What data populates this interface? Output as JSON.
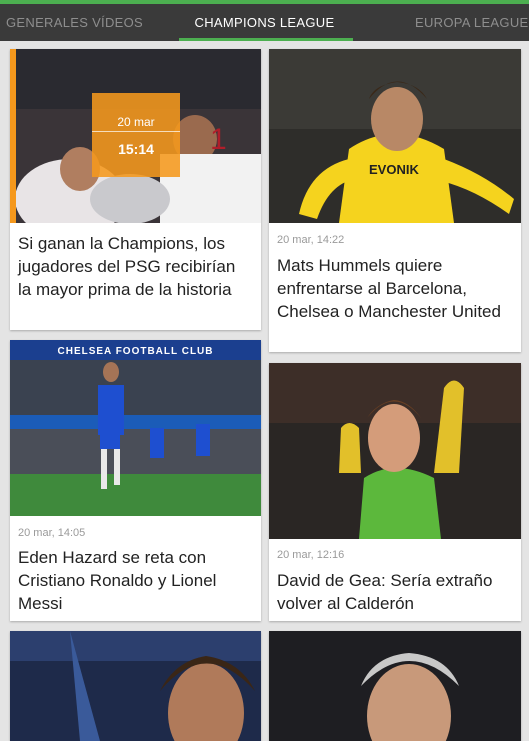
{
  "tabs": [
    {
      "label": "GENERALES VÍDEOS"
    },
    {
      "label": "CHAMPIONS LEAGUE"
    },
    {
      "label": "EUROPA LEAGUE"
    }
  ],
  "colors": {
    "accent": "#4caf50",
    "highlight": "#f5981c",
    "tabbar": "#3a3a3a"
  },
  "cards": [
    {
      "date": "20 mar",
      "time": "15:14",
      "title": "Si ganan la Champions, los jugadores del PSG recibirían la mayor prima de la historia"
    },
    {
      "meta": "20 mar, 14:22",
      "title": "Mats Hummels quiere enfrentarse al Barcelona, Chelsea o Manchester United"
    },
    {
      "meta": "20 mar, 14:05",
      "title": "Eden Hazard se reta con Cristiano Ronaldo y Lionel Messi",
      "banner_text": "CHELSEA FOOTBALL CLUB"
    },
    {
      "meta": "20 mar, 12:16",
      "title": "David de Gea: Sería extraño volver al Calderón"
    }
  ]
}
